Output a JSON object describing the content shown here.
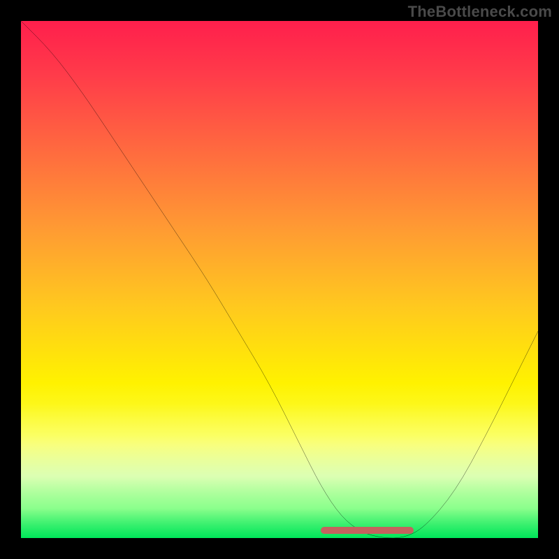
{
  "watermark": "TheBottleneck.com",
  "colors": {
    "background": "#000000",
    "curve": "#000000",
    "optimal_mark": "#c4625e",
    "gradient_top": "#ff1f4c",
    "gradient_bottom": "#00e65a"
  },
  "chart_data": {
    "type": "line",
    "title": "",
    "xlabel": "",
    "ylabel": "",
    "xlim": [
      0,
      100
    ],
    "ylim": [
      0,
      100
    ],
    "grid": false,
    "legend": false,
    "background_gradient": {
      "direction": "vertical",
      "meaning": "red (top) = high bottleneck, green (bottom) = balanced",
      "stops": [
        {
          "pos": 0,
          "color": "#ff1f4c"
        },
        {
          "pos": 25,
          "color": "#ff6a3f"
        },
        {
          "pos": 55,
          "color": "#ffc81f"
        },
        {
          "pos": 80,
          "color": "#faff3f"
        },
        {
          "pos": 100,
          "color": "#00e65a"
        }
      ]
    },
    "series": [
      {
        "name": "bottleneck-curve",
        "x": [
          0,
          6,
          12,
          18,
          24,
          30,
          36,
          42,
          48,
          54,
          58,
          62,
          66,
          70,
          74,
          78,
          84,
          90,
          96,
          100
        ],
        "y": [
          100,
          94,
          86,
          77,
          68,
          59,
          50,
          40,
          30,
          18,
          10,
          4,
          1,
          0,
          0,
          2,
          9,
          20,
          32,
          40
        ]
      }
    ],
    "optimal_range_x": [
      58,
      76
    ],
    "optimal_mark": {
      "color": "#c4625e",
      "thickness_px": 10
    }
  }
}
